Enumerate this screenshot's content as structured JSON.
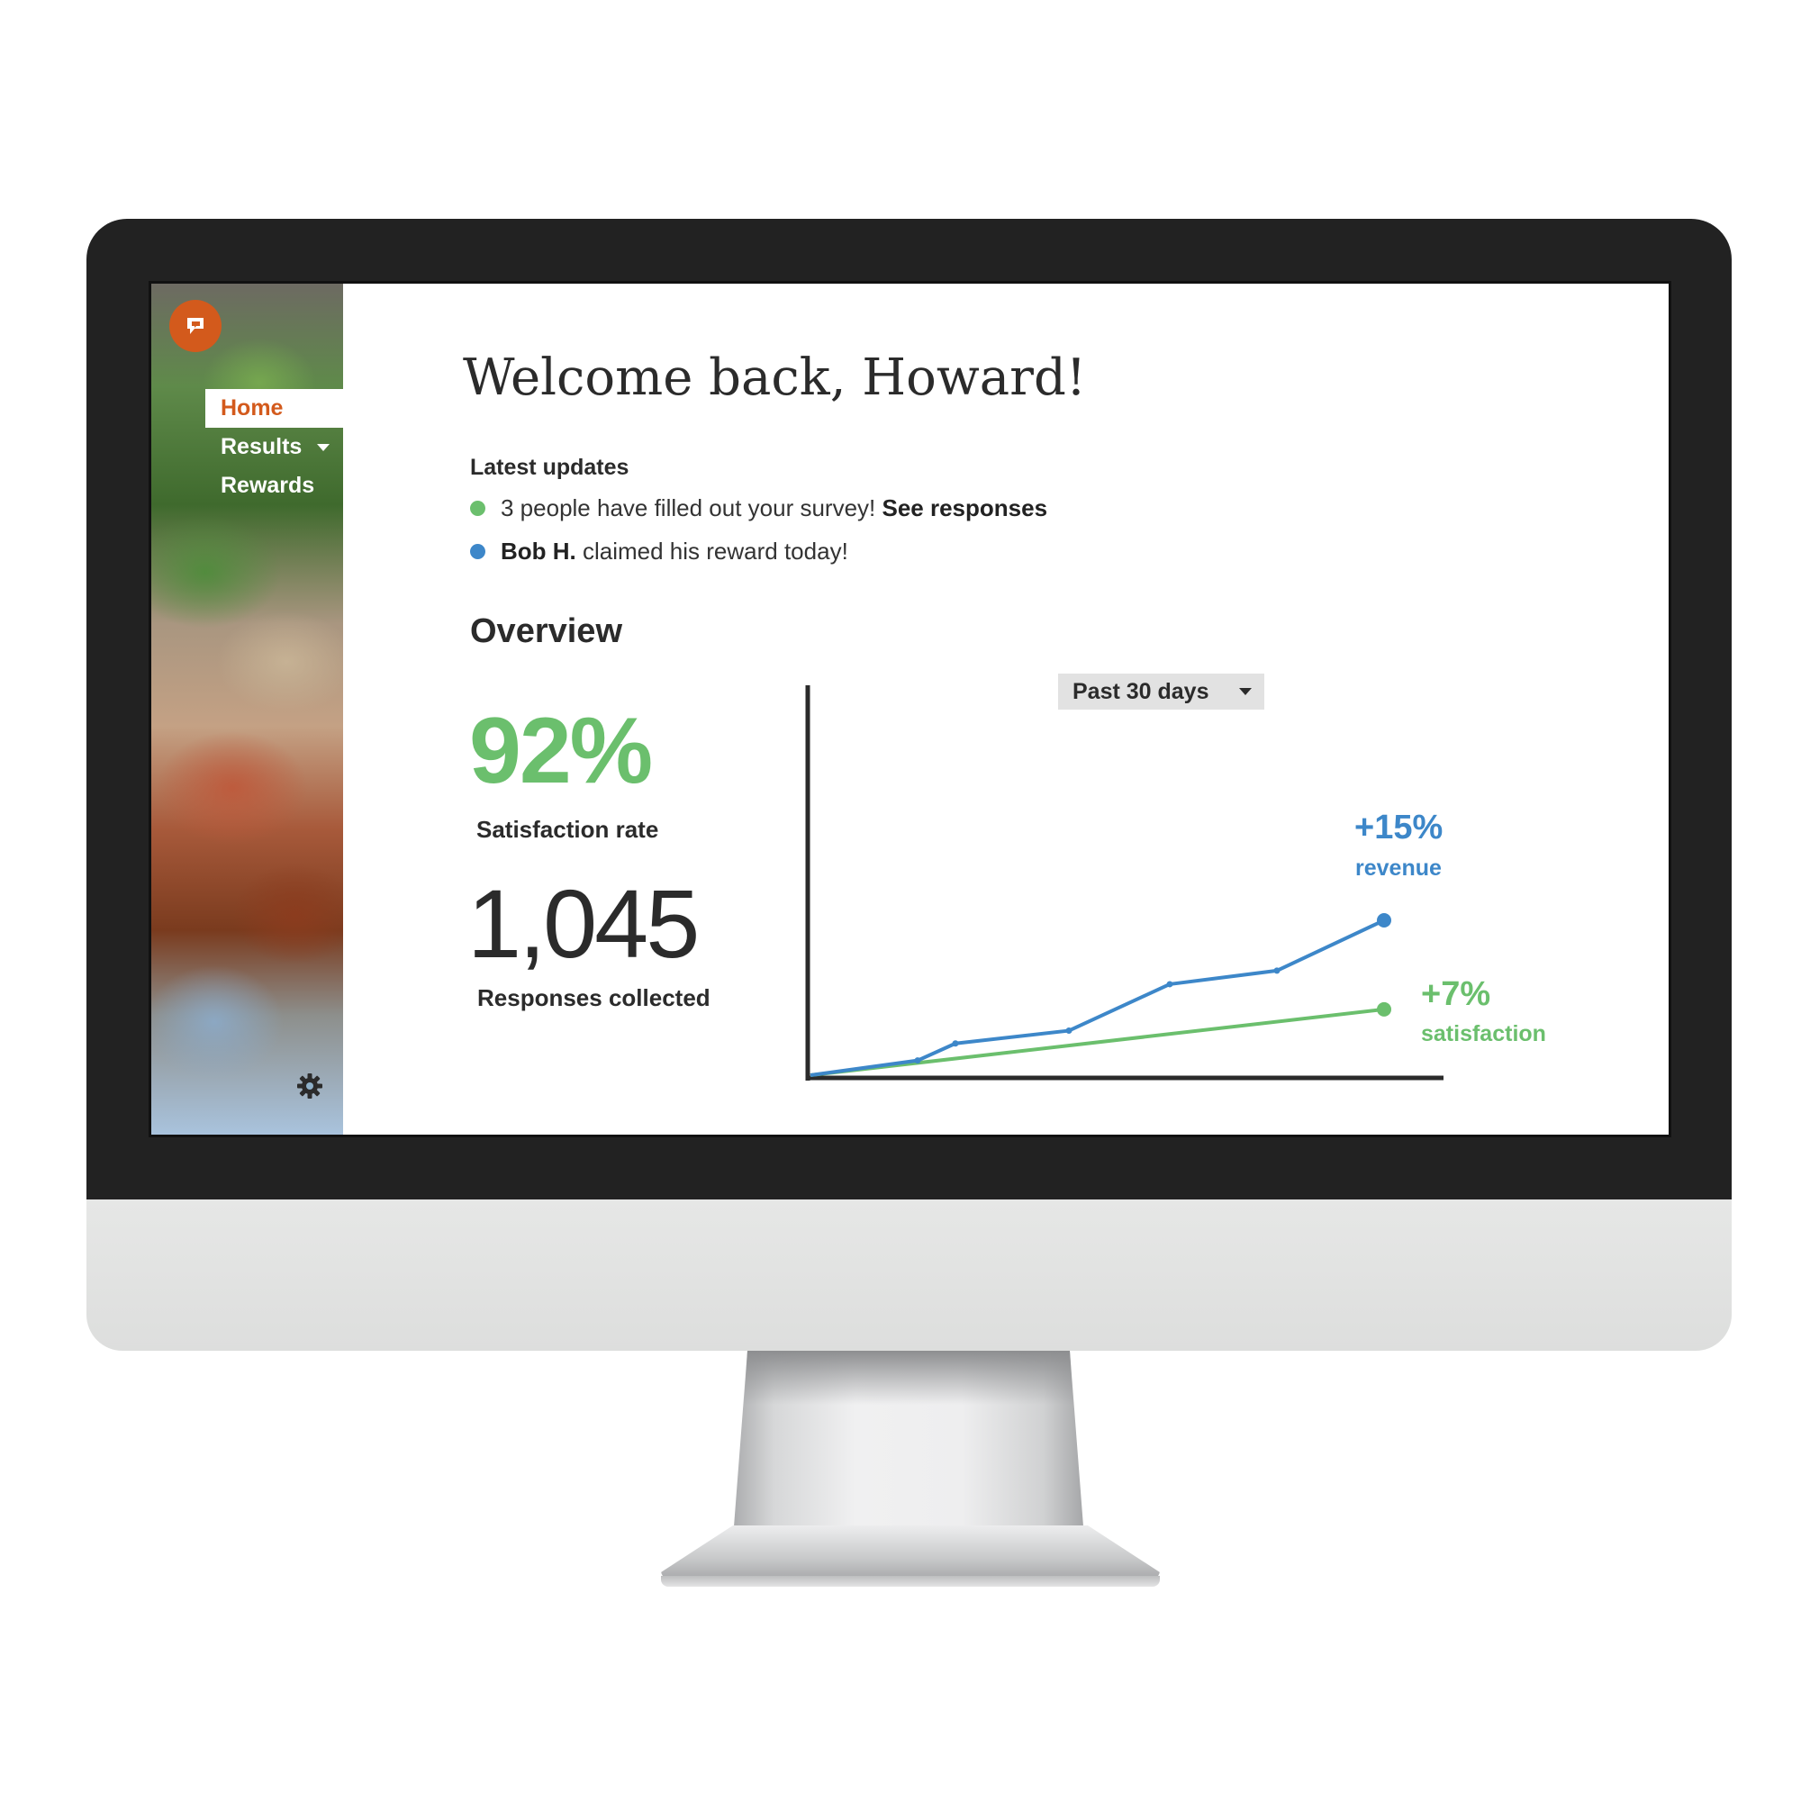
{
  "sidebar": {
    "logo_icon": "speech-bubble-logo-icon",
    "items": [
      {
        "label": "Home",
        "active": true
      },
      {
        "label": "Results",
        "has_dropdown": true
      },
      {
        "label": "Rewards"
      }
    ],
    "settings_icon": "gear-icon"
  },
  "header": {
    "welcome": "Welcome back, Howard!"
  },
  "updates": {
    "title": "Latest updates",
    "items": [
      {
        "color": "#6bbf6d",
        "prefix": "3 people have filled out your survey! ",
        "strong": "See responses"
      },
      {
        "color": "#3d87c9",
        "strong": "Bob H.",
        "suffix": " claimed his reward today!"
      }
    ]
  },
  "overview": {
    "title": "Overview",
    "satisfaction_value": "92%",
    "satisfaction_label": "Satisfaction rate",
    "responses_value": "1,045",
    "responses_label": "Responses collected",
    "period_selected": "Past 30 days"
  },
  "colors": {
    "accent": "#d35a1c",
    "green": "#6bbf6d",
    "blue": "#3d87c9",
    "text": "#2b2b2b"
  },
  "chart_data": {
    "type": "line",
    "series": [
      {
        "name": "revenue",
        "color": "#3d87c9",
        "points": [
          [
            0,
            0
          ],
          [
            0.17,
            0.038
          ],
          [
            0.23,
            0.082
          ],
          [
            0.41,
            0.115
          ],
          [
            0.57,
            0.235
          ],
          [
            0.74,
            0.27
          ],
          [
            0.91,
            0.4
          ]
        ],
        "label_value": "+15%",
        "label_name": "revenue"
      },
      {
        "name": "satisfaction",
        "color": "#6bbf6d",
        "points": [
          [
            0,
            0
          ],
          [
            0.91,
            0.17
          ]
        ],
        "label_value": "+7%",
        "label_name": "satisfaction"
      }
    ]
  }
}
